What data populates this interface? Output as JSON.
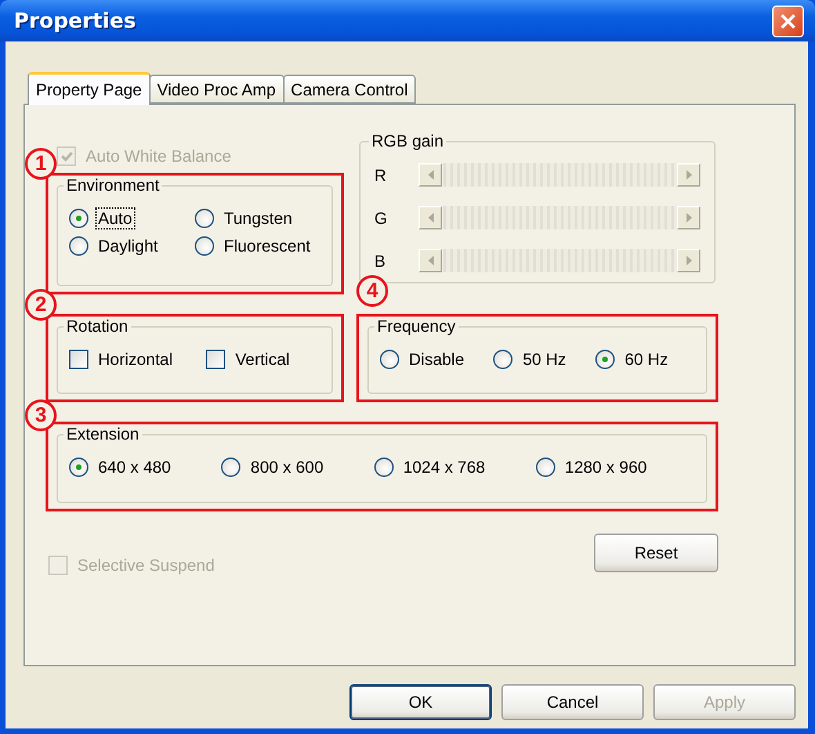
{
  "window": {
    "title": "Properties"
  },
  "tabs": [
    {
      "label": "Property Page",
      "selected": true
    },
    {
      "label": "Video Proc Amp",
      "selected": false
    },
    {
      "label": "Camera Control",
      "selected": false
    }
  ],
  "auto_white_balance": {
    "label": "Auto White Balance",
    "checked": true,
    "disabled": true
  },
  "environment": {
    "callout": "1",
    "title": "Environment",
    "options": [
      {
        "label": "Auto",
        "selected": true,
        "focused": true
      },
      {
        "label": "Tungsten",
        "selected": false,
        "focused": false
      },
      {
        "label": "Daylight",
        "selected": false,
        "focused": false
      },
      {
        "label": "Fluorescent",
        "selected": false,
        "focused": false
      }
    ]
  },
  "rgb_gain": {
    "title": "RGB gain",
    "disabled": true,
    "channels": [
      {
        "label": "R"
      },
      {
        "label": "G"
      },
      {
        "label": "B"
      }
    ]
  },
  "rotation": {
    "callout": "2",
    "title": "Rotation",
    "options": [
      {
        "label": "Horizontal",
        "checked": false
      },
      {
        "label": "Vertical",
        "checked": false
      }
    ]
  },
  "frequency": {
    "callout": "4",
    "title": "Frequency",
    "options": [
      {
        "label": "Disable",
        "selected": false
      },
      {
        "label": "50 Hz",
        "selected": false
      },
      {
        "label": "60 Hz",
        "selected": true
      }
    ]
  },
  "extension": {
    "callout": "3",
    "title": "Extension",
    "options": [
      {
        "label": "640 x 480",
        "selected": true
      },
      {
        "label": "800 x 600",
        "selected": false
      },
      {
        "label": "1024 x 768",
        "selected": false
      },
      {
        "label": "1280 x 960",
        "selected": false
      }
    ]
  },
  "selective_suspend": {
    "label": "Selective Suspend",
    "checked": false,
    "disabled": true
  },
  "reset_button": {
    "label": "Reset"
  },
  "buttons": [
    {
      "label": "OK",
      "default": true,
      "disabled": false
    },
    {
      "label": "Cancel",
      "default": false,
      "disabled": false
    },
    {
      "label": "Apply",
      "default": false,
      "disabled": true
    }
  ]
}
